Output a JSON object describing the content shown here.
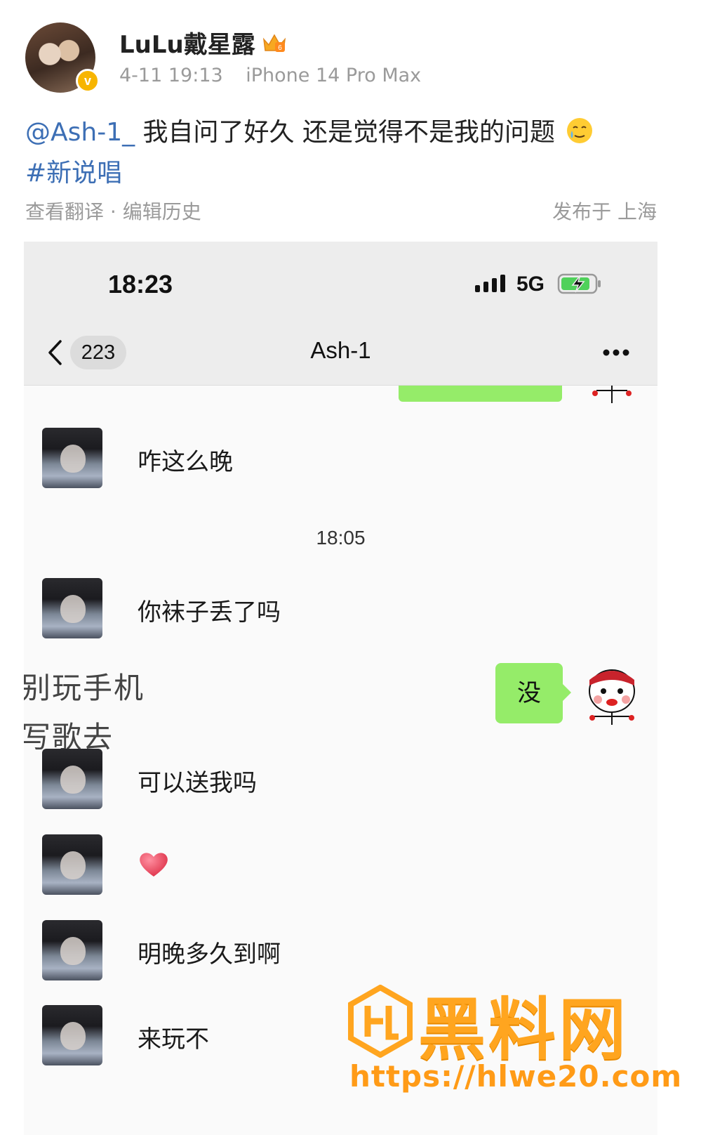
{
  "post": {
    "username": "LuLu戴星露",
    "timestamp": "4-11 19:13",
    "device": "iPhone 14 Pro Max",
    "mention": "@Ash-1_",
    "text": "我自问了好久 还是觉得不是我的问题",
    "emoji": "crying-smile",
    "hashtag": "#新说唱",
    "actions": "查看翻译 · 编辑历史",
    "location": "发布于 上海"
  },
  "chat": {
    "status_time": "18:23",
    "network": "5G",
    "unread_count": "223",
    "title": "Ash-1",
    "messages": [
      {
        "text": "咋这么晚"
      },
      {
        "text": "你袜子丢了吗"
      },
      {
        "text": "可以送我吗"
      },
      {
        "text": ""
      },
      {
        "text": "明晚多久到啊"
      },
      {
        "text": "来玩不"
      }
    ],
    "time_divider": "18:05",
    "my_reply": "没",
    "overlay_lines": [
      "别玩手机",
      "写歌去"
    ]
  },
  "watermark": {
    "title": "黑料网",
    "url": "https://hlwe20.com"
  },
  "colors": {
    "link": "#3d6fb5",
    "bubble_green": "#95ec69",
    "watermark_orange": "#ffa51f"
  }
}
